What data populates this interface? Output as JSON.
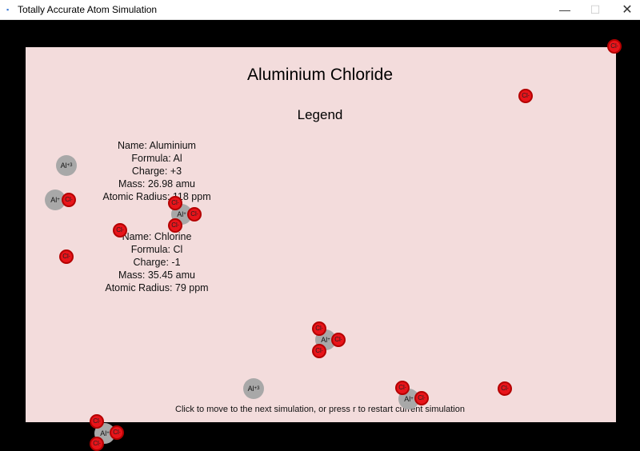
{
  "window": {
    "title": "Totally Accurate Atom Simulation",
    "minimize_glyph": "—",
    "maximize_glyph": "☐",
    "close_glyph": "✕",
    "app_icon": "app-icon"
  },
  "simulation": {
    "title": "Aluminium Chloride",
    "legend_title": "Legend",
    "aluminium_info": {
      "name": "Name: Aluminium",
      "formula": "Formula: Al",
      "charge": "Charge: +3",
      "mass": "Mass: 26.98 amu",
      "radius": "Atomic Radius: 118 ppm"
    },
    "chlorine_info": {
      "name": "Name: Chlorine",
      "formula": "Formula: Cl",
      "charge": "Charge: -1",
      "mass": "Mass: 35.45 amu",
      "radius": "Atomic Radius: 79 ppm"
    },
    "footer": "Click to move to the next simulation, or press r to restart current simulation"
  },
  "labels": {
    "al_symbol": "Al",
    "al_charge": "+3",
    "al_partial": "+",
    "cl_symbol": "Cl",
    "cl_charge": "-"
  },
  "colors": {
    "background": "#000000",
    "canvas": "#f3dcdc",
    "aluminium": "#a8a8a8",
    "chlorine": "#e8141a"
  }
}
